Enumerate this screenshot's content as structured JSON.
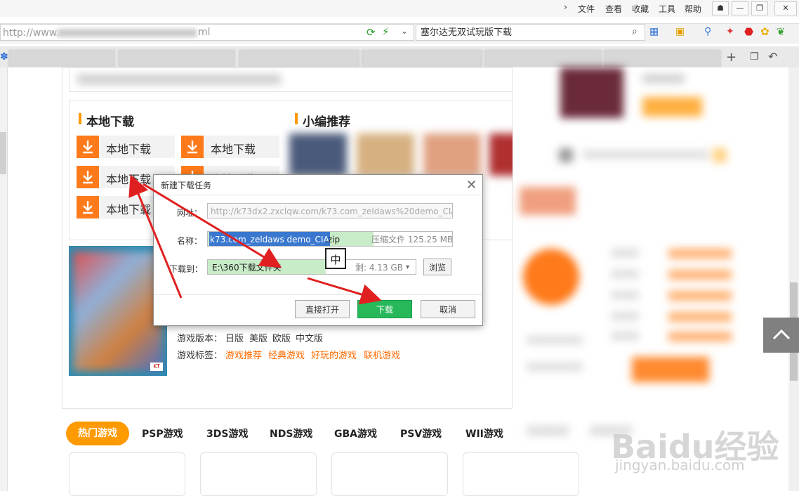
{
  "menubar": {
    "items": [
      "文件",
      "查看",
      "收藏",
      "工具",
      "帮助"
    ]
  },
  "address": {
    "url": "http://www.",
    "url_tail": "ml",
    "search": "塞尔达无双试玩版下载"
  },
  "local_download": {
    "title": "本地下载",
    "buttons": [
      "本地下载",
      "本地下载",
      "本地下载",
      "本地下载",
      "本地下载"
    ]
  },
  "recommend": {
    "title": "小编推荐"
  },
  "game_info": {
    "version_label": "游戏版本：",
    "versions": [
      "日版",
      "美版",
      "欧版",
      "中文版"
    ],
    "tags_label": "游戏标签：",
    "tags": [
      "游戏推荐",
      "经典游戏",
      "好玩的游戏",
      "联机游戏"
    ]
  },
  "categories": [
    "热门游戏",
    "PSP游戏",
    "3DS游戏",
    "NDS游戏",
    "GBA游戏",
    "PSV游戏",
    "WII游戏"
  ],
  "dialog": {
    "title": "新建下载任务",
    "url_label": "网址：",
    "url_value_host": "http://k73dx2.zxclqw.com",
    "url_value_path": "/k73.com_zeldaws%20demo_CIA.",
    "name_label": "名称：",
    "name_value": "k73.com_zeldaws demo_CIA",
    "name_ext": ".zip",
    "size_text": "压缩文件 125.25 MB",
    "saveto_label": "下载到：",
    "saveto_value": "E:\\360下载文件夹",
    "free_text": "剩: 4.13 GB",
    "browse": "浏览",
    "open_direct": "直接打开",
    "download": "下载",
    "cancel": "取消",
    "ime": "中"
  },
  "watermark": {
    "main": "Baidu经验",
    "sub": "jingyan.baidu.com"
  },
  "colors": {
    "accent_orange": "#ff7a1a",
    "download_green": "#27b85a",
    "arrow_red": "#e02020"
  }
}
